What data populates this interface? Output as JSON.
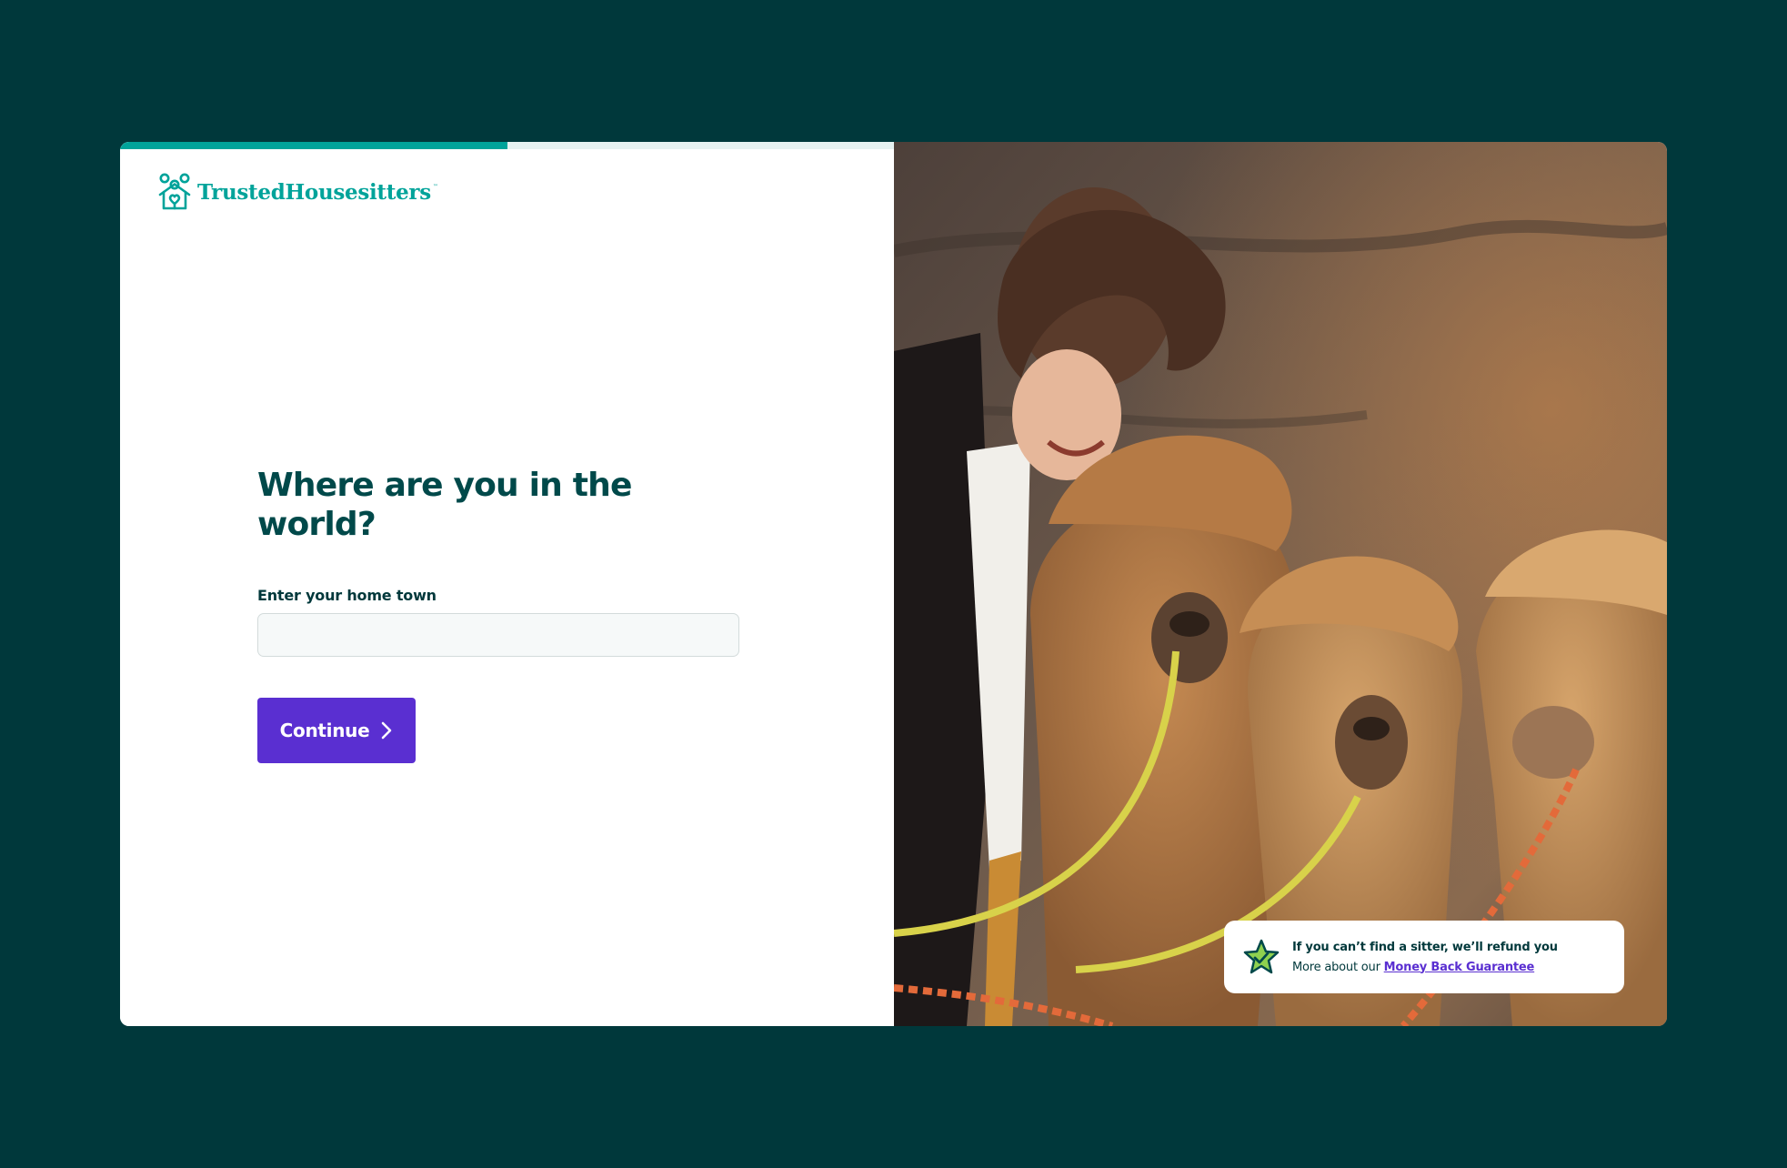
{
  "brand": {
    "name": "TrustedHousesitters",
    "tm": "™",
    "accent_color": "#00a39a",
    "icon": "house-paw-logo-icon"
  },
  "progress": {
    "fraction": 0.5,
    "color": "#00a39a"
  },
  "form": {
    "heading": "Where are you in the world?",
    "field_label": "Enter your home town",
    "field_value": "",
    "field_placeholder": "",
    "continue_label": "Continue",
    "continue_icon": "chevron-right-icon",
    "button_color": "#5a2fd1"
  },
  "hero": {
    "image": "woman-with-alpacas-photo"
  },
  "guarantee": {
    "icon": "star-check-icon",
    "title": "If you can’t find a sitter, we’ll refund you",
    "text": "More about our ",
    "link_label": "Money Back Guarantee"
  },
  "colors": {
    "page_background": "#00383b",
    "heading_color": "#00494a"
  }
}
